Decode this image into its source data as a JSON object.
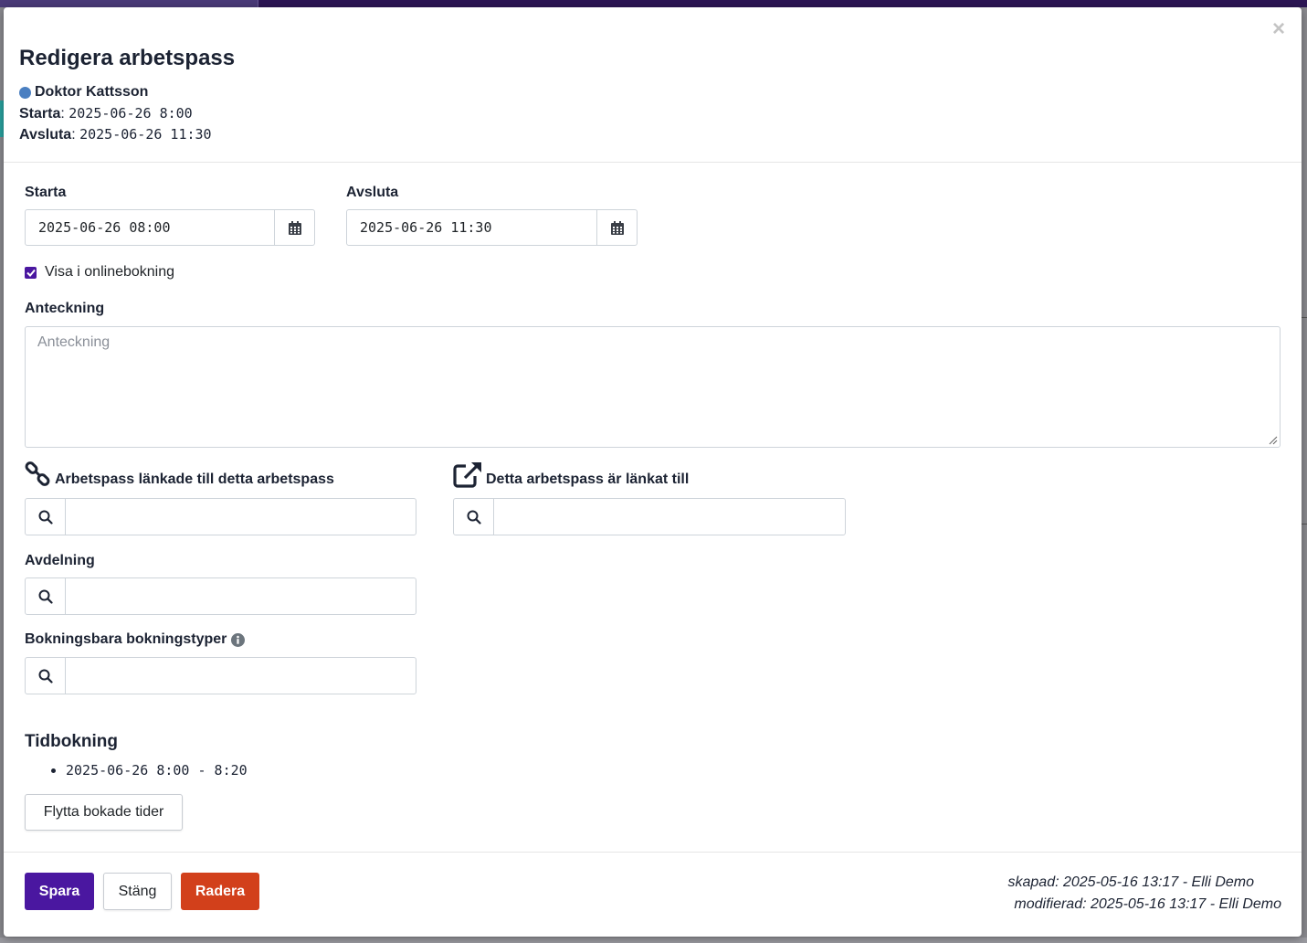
{
  "modal": {
    "title": "Redigera arbetspass",
    "close_symbol": "×",
    "staff_name": "Doktor Kattsson",
    "staff_color": "#4a7fc1",
    "start_label": "Starta",
    "start_value": "2025-06-26 8:00",
    "end_label": "Avsluta",
    "end_value": "2025-06-26 11:30"
  },
  "form": {
    "start_label": "Starta",
    "start_input": "2025-06-26 08:00",
    "end_label": "Avsluta",
    "end_input": "2025-06-26 11:30",
    "online_booking_label": "Visa i onlinebokning",
    "online_booking_checked": true,
    "note_label": "Anteckning",
    "note_placeholder": "Anteckning",
    "linked_to_this_label": "Arbetspass länkade till detta arbetspass",
    "linked_from_label": "Detta arbetspass är länkat till",
    "department_label": "Avdelning",
    "booking_types_label": "Bokningsbara bokningstyper"
  },
  "tidbokning": {
    "title": "Tidbokning",
    "items": [
      "2025-06-26 8:00 - 8:20"
    ],
    "move_button": "Flytta bokade tider"
  },
  "footer": {
    "save": "Spara",
    "close": "Stäng",
    "delete": "Radera",
    "created": "skapad: 2025-05-16 13:17 - Elli Demo",
    "modified": "modifierad: 2025-05-16 13:17 - Elli Demo"
  },
  "colors": {
    "primary": "#4a17a0",
    "danger": "#d2401b",
    "text": "#1c2333"
  },
  "icons": [
    "calendar-icon",
    "link-icon",
    "external-link-icon",
    "search-icon",
    "info-icon",
    "close-icon",
    "check-icon"
  ]
}
